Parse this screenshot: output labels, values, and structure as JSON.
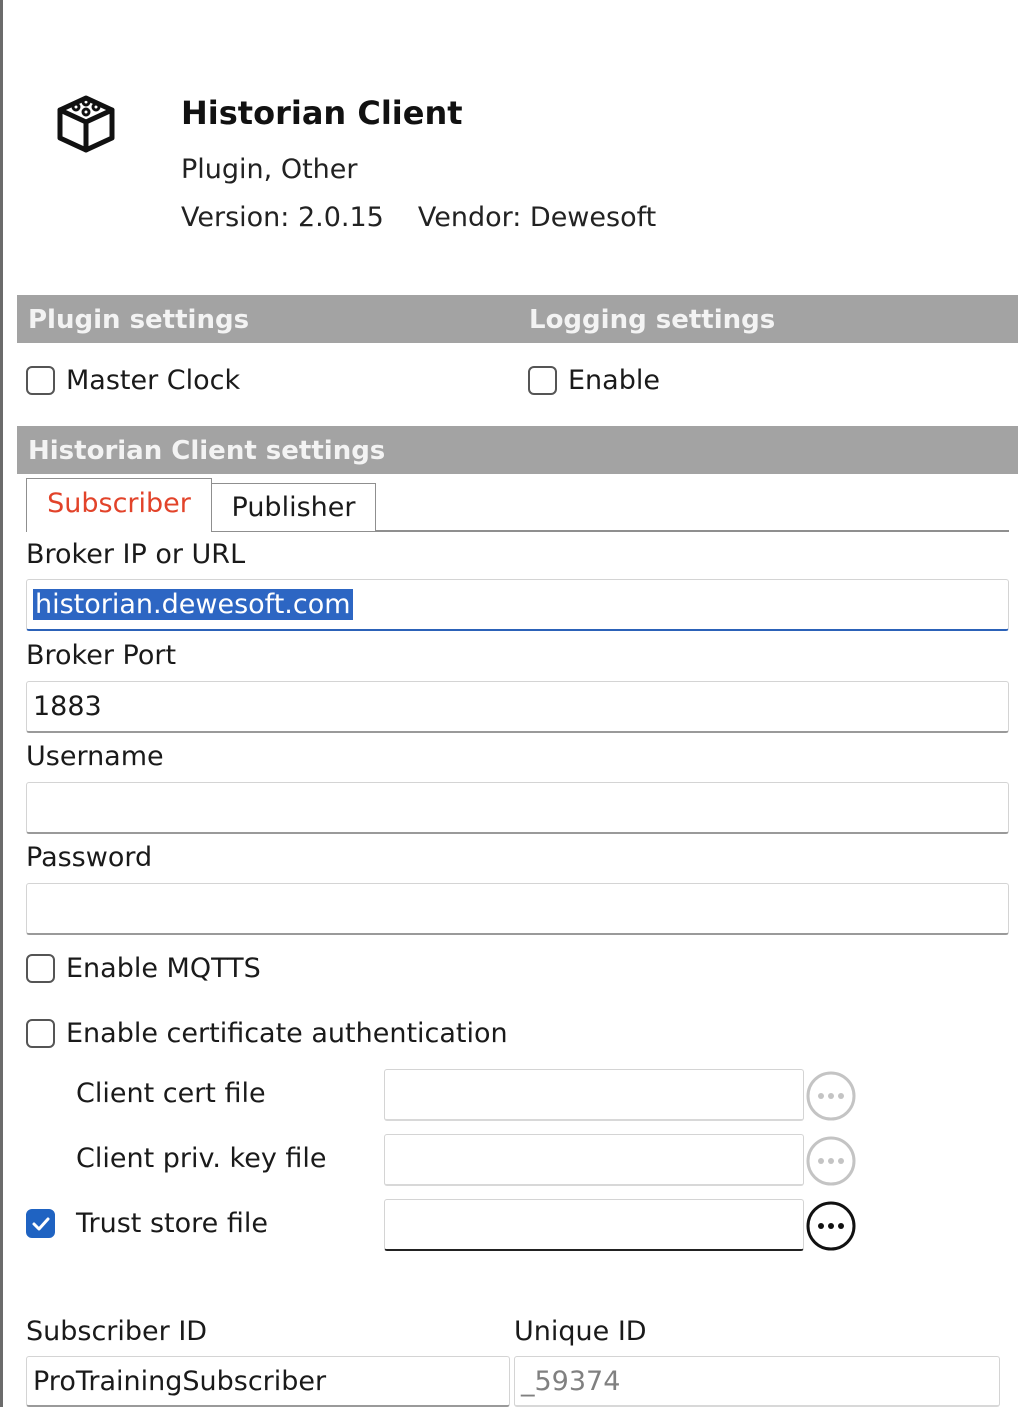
{
  "header": {
    "icon": "plugin-box-icon",
    "title": "Historian Client",
    "category": "Plugin, Other",
    "version_text": "Version: 2.0.15",
    "vendor_text": "Vendor: Dewesoft"
  },
  "plugin_settings": {
    "heading": "Plugin settings",
    "master_clock": {
      "label": "Master Clock",
      "checked": false
    }
  },
  "logging_settings": {
    "heading": "Logging settings",
    "enable": {
      "label": "Enable",
      "checked": false
    }
  },
  "client_settings": {
    "heading": "Historian Client settings",
    "tabs": [
      {
        "label": "Subscriber",
        "active": true
      },
      {
        "label": "Publisher",
        "active": false
      }
    ],
    "broker_ip": {
      "label": "Broker IP or URL",
      "value": "historian.dewesoft.com"
    },
    "broker_port": {
      "label": "Broker Port",
      "value": "1883"
    },
    "username": {
      "label": "Username",
      "value": ""
    },
    "password": {
      "label": "Password",
      "value": ""
    },
    "enable_mqtts": {
      "label": "Enable MQTTS",
      "checked": false
    },
    "enable_cert_auth": {
      "label": "Enable certificate authentication",
      "checked": false
    },
    "client_cert_file": {
      "label": "Client cert file",
      "value": "",
      "enabled": false
    },
    "client_priv_key_file": {
      "label": "Client priv. key file",
      "value": "",
      "enabled": false
    },
    "trust_store_file": {
      "label": "Trust store file",
      "value": "",
      "checked": true,
      "enabled": true
    },
    "subscriber_id": {
      "label": "Subscriber ID",
      "value": "ProTrainingSubscriber"
    },
    "unique_id": {
      "label": "Unique ID",
      "value": "_59374"
    }
  },
  "colors": {
    "section_bar": "#a3a3a3",
    "active_tab_text": "#e2432a",
    "checkbox_checked": "#1f63c2",
    "selection_highlight": "#2d66c3"
  }
}
